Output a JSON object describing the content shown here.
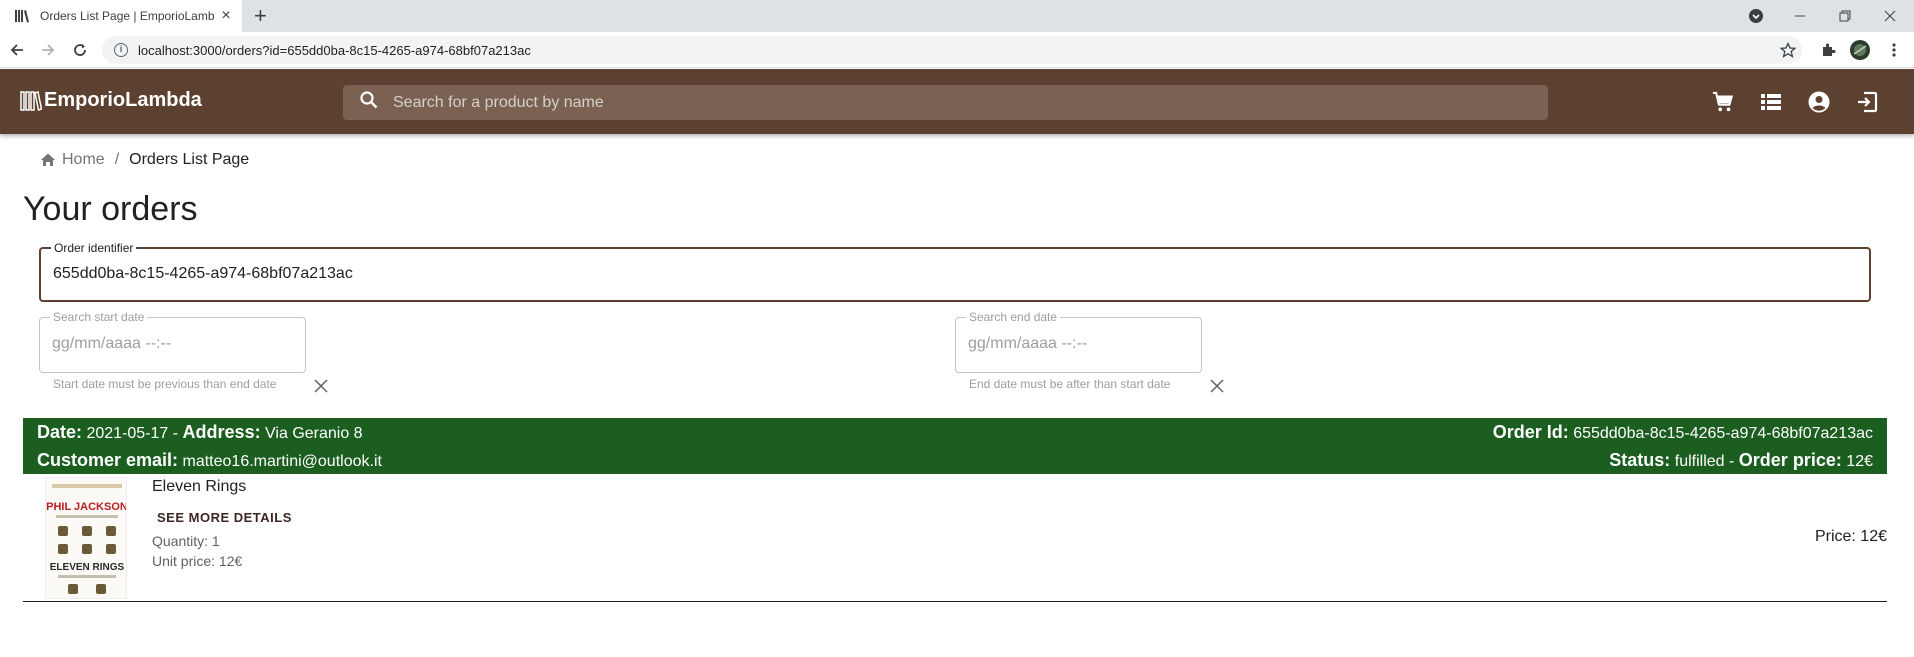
{
  "browser": {
    "tab_title": "Orders List Page | EmporioLambda",
    "url": "localhost:3000/orders?id=655dd0ba-8c15-4265-a974-68bf07a213ac"
  },
  "appbar": {
    "brand": "EmporioLambda",
    "search_placeholder": "Search for a product by name",
    "icons": [
      "cart-icon",
      "list-icon",
      "account-icon",
      "logout-icon"
    ]
  },
  "breadcrumb": {
    "home": "Home",
    "separator": "/",
    "current": "Orders List Page"
  },
  "page_title": "Your orders",
  "filters": {
    "order_id_label": "Order identifier",
    "order_id_value": "655dd0ba-8c15-4265-a974-68bf07a213ac",
    "start_label": "Search start date",
    "start_placeholder": "gg/mm/aaaa --:--",
    "start_helper": "Start date must be previous than end date",
    "end_label": "Search end date",
    "end_placeholder": "gg/mm/aaaa --:--",
    "end_helper": "End date must be after than start date"
  },
  "order": {
    "date_label": "Date:",
    "date": "2021-05-17",
    "dash": "-",
    "address_label": "Address:",
    "address": "Via Geranio 8",
    "order_id_label": "Order Id:",
    "order_id": "655dd0ba-8c15-4265-a974-68bf07a213ac",
    "email_label": "Customer email:",
    "email": "matteo16.martini@outlook.it",
    "status_label": "Status:",
    "status": "fulfilled",
    "price_label": "Order price:",
    "price": "12€",
    "header_color": "#1b5e20",
    "items": [
      {
        "title": "Eleven Rings",
        "see_more": "SEE MORE DETAILS",
        "quantity": "Quantity: 1",
        "unit_price": "Unit price: 12€",
        "price": "Price: 12€",
        "cover_author": "PHIL JACKSON",
        "cover_title": "ELEVEN RINGS"
      }
    ]
  },
  "colors": {
    "appbar": "#5d4130",
    "accent": "#5d4130"
  }
}
